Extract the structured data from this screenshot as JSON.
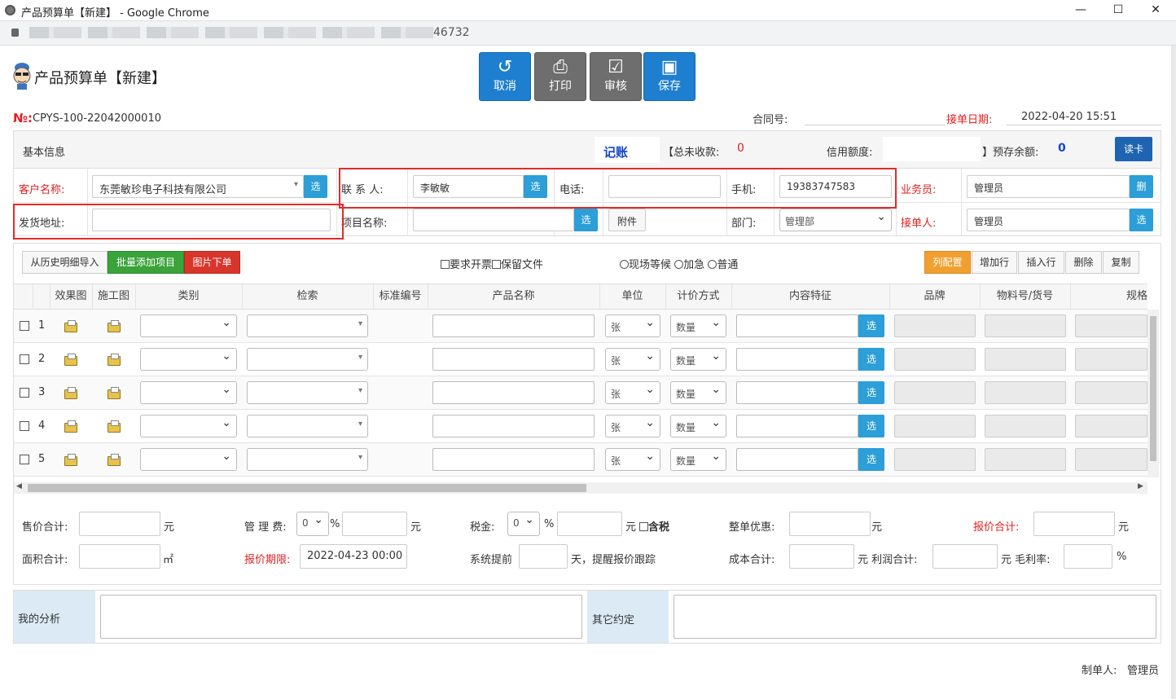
{
  "window": {
    "title": "产品预算单【新建】 - Google Chrome",
    "url_tail": "46732"
  },
  "header": {
    "title": "产品预算单【新建】"
  },
  "toolbar": {
    "cancel": "取消",
    "print": "打印",
    "audit": "审核",
    "save": "保存"
  },
  "doc": {
    "no_label": "№:",
    "no_value": "CPYS-100-22042000010",
    "contract_label": "合同号:",
    "contract_value": "",
    "date_label": "接单日期:",
    "date_value": "2022-04-20 15:51"
  },
  "basic": {
    "title": "基本信息",
    "bookkeep": "记账",
    "unpaid_label": "【总未收款:",
    "unpaid_value": "0",
    "credit_label": "信用额度:",
    "credit_value": "",
    "prepay_label": "】预存余额:",
    "prepay_value": "0",
    "read_card": "读卡"
  },
  "form": {
    "customer_label": "客户名称:",
    "customer_value": "东莞敏珍电子科技有限公司",
    "contact_label": "联 系 人:",
    "contact_value": "李敏敏",
    "phone_label": "电话:",
    "phone_value": "",
    "mobile_label": "手机:",
    "mobile_value": "19383747583",
    "salesman_label": "业务员:",
    "salesman_value": "管理员",
    "salesman_btn": "删",
    "address_label": "发货地址:",
    "address_value": "",
    "project_label": "项目名称:",
    "project_value": "",
    "attach": "附件",
    "dept_label": "部门:",
    "dept_value": "管理部",
    "receiver_label": "接单人:",
    "receiver_value": "管理员",
    "select_btn": "选"
  },
  "actions": {
    "import_history": "从历史明细导入",
    "batch_add": "批量添加项目",
    "image_order": "图片下单",
    "need_invoice": "要求开票",
    "keep_file": "保留文件",
    "urgency": [
      "现场等候",
      "加急",
      "普通"
    ],
    "col_config": "列配置",
    "add_row": "增加行",
    "insert_row": "插入行",
    "delete": "删除",
    "copy": "复制"
  },
  "table": {
    "headers": [
      "效果图",
      "施工图",
      "类别",
      "检索",
      "标准编号",
      "产品名称",
      "单位",
      "计价方式",
      "内容特征",
      "品牌",
      "物料号/货号",
      "规格"
    ],
    "rows": [
      {
        "no": "1",
        "unit": "张",
        "pricing": "数量"
      },
      {
        "no": "2",
        "unit": "张",
        "pricing": "数量"
      },
      {
        "no": "3",
        "unit": "张",
        "pricing": "数量"
      },
      {
        "no": "4",
        "unit": "张",
        "pricing": "数量"
      },
      {
        "no": "5",
        "unit": "张",
        "pricing": "数量"
      }
    ],
    "select_btn": "选"
  },
  "totals": {
    "price_total_label": "售价合计:",
    "yuan": "元",
    "mgmt_fee_label": "管 理 费:",
    "mgmt_fee_pct": "0",
    "pct": "%",
    "tax_label": "税金:",
    "tax_pct": "0",
    "tax_incl": "含税",
    "discount_label": "整单优惠:",
    "quote_total_label": "报价合计:",
    "area_label": "面积合计:",
    "area_unit": "㎡",
    "quote_deadline_label": "报价期限:",
    "quote_deadline_value": "2022-04-23 00:00",
    "remind_prefix": "系统提前",
    "remind_suffix": "天，提醒报价跟踪",
    "cost_label": "成本合计:",
    "profit_label": "元 利润合计:",
    "margin_label": "元 毛利率:"
  },
  "notes": {
    "my_analysis": "我的分析",
    "other_terms": "其它约定"
  },
  "footer": {
    "maker_label": "制单人:",
    "maker_value": "管理员"
  }
}
